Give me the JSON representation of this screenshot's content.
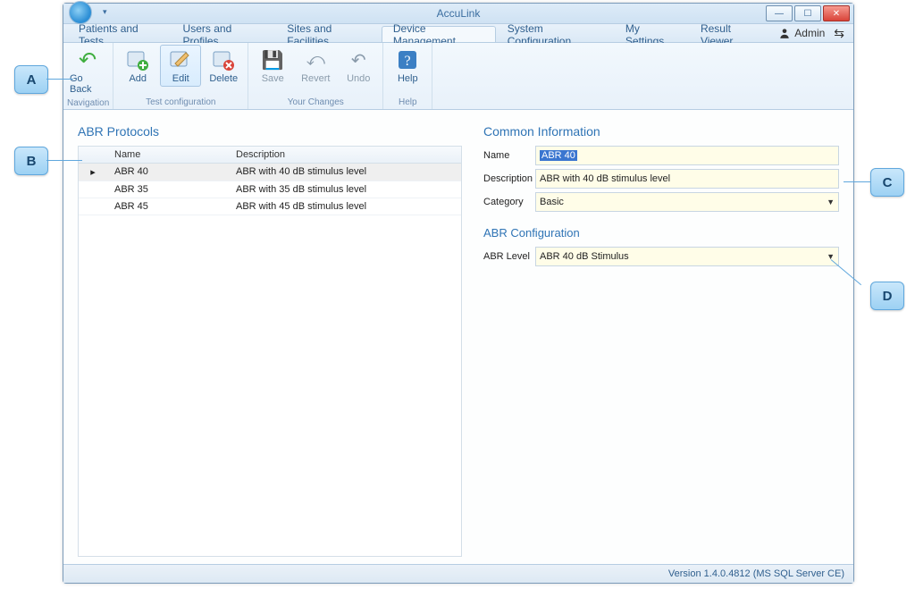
{
  "titlebar": {
    "appTitle": "AccuLink"
  },
  "menu": {
    "tabs": [
      "Patients and Tests",
      "Users and Profiles",
      "Sites and Facilities",
      "Device Management",
      "System Configuration",
      "My Settings",
      "Result Viewer"
    ],
    "activeIndex": 3,
    "userLabel": "Admin"
  },
  "ribbon": {
    "groups": [
      {
        "label": "Navigation",
        "buttons": [
          {
            "id": "go-back",
            "label": "Go Back",
            "icon": "↩"
          }
        ]
      },
      {
        "label": "Test configuration",
        "buttons": [
          {
            "id": "add",
            "label": "Add",
            "icon": "＋"
          },
          {
            "id": "edit",
            "label": "Edit",
            "icon": "✎",
            "active": true
          },
          {
            "id": "delete",
            "label": "Delete",
            "icon": "✖"
          }
        ]
      },
      {
        "label": "Your Changes",
        "buttons": [
          {
            "id": "save",
            "label": "Save",
            "icon": "💾",
            "disabled": true
          },
          {
            "id": "revert",
            "label": "Revert",
            "icon": "⤺",
            "disabled": true
          },
          {
            "id": "undo",
            "label": "Undo",
            "icon": "↶",
            "disabled": true
          }
        ]
      },
      {
        "label": "Help",
        "buttons": [
          {
            "id": "help",
            "label": "Help",
            "icon": "?"
          }
        ]
      }
    ]
  },
  "leftPanel": {
    "title": "ABR Protocols",
    "columns": {
      "name": "Name",
      "description": "Description"
    },
    "rows": [
      {
        "name": "ABR 40",
        "desc": "ABR with 40 dB stimulus level",
        "selected": true
      },
      {
        "name": "ABR 35",
        "desc": "ABR with 35 dB stimulus level"
      },
      {
        "name": "ABR 45",
        "desc": "ABR with 45 dB stimulus level"
      }
    ]
  },
  "rightPanel": {
    "commonTitle": "Common Information",
    "name": {
      "label": "Name",
      "value": "ABR 40"
    },
    "description": {
      "label": "Description",
      "value": "ABR with 40 dB stimulus level"
    },
    "category": {
      "label": "Category",
      "value": "Basic"
    },
    "abrConfigTitle": "ABR Configuration",
    "abrLevel": {
      "label": "ABR Level",
      "value": "ABR 40 dB Stimulus"
    }
  },
  "statusbar": {
    "version": "Version 1.4.0.4812 (MS SQL Server CE)"
  },
  "callouts": {
    "A": "A",
    "B": "B",
    "C": "C",
    "D": "D"
  }
}
